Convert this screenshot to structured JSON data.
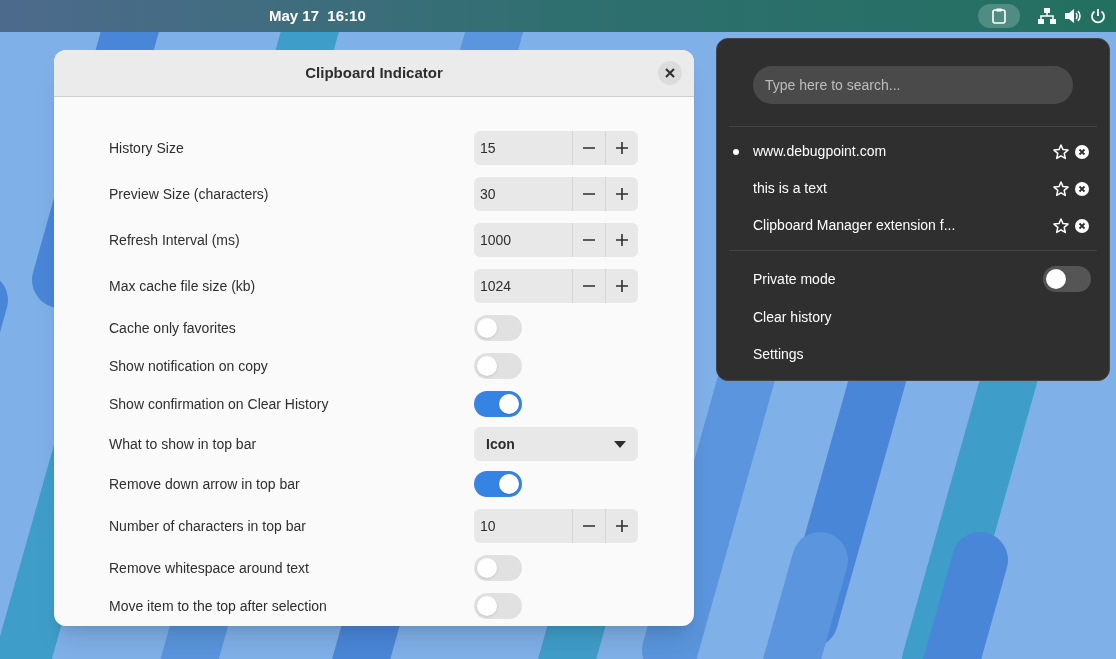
{
  "top_bar": {
    "clock": "May 17  16:10"
  },
  "dialog": {
    "title": "Clipboard Indicator",
    "rows": [
      {
        "kind": "spin",
        "label": "History Size",
        "value": "15"
      },
      {
        "kind": "spin",
        "label": "Preview Size (characters)",
        "value": "30"
      },
      {
        "kind": "spin",
        "label": "Refresh Interval (ms)",
        "value": "1000"
      },
      {
        "kind": "spin",
        "label": "Max cache file size (kb)",
        "value": "1024"
      },
      {
        "kind": "switch",
        "label": "Cache only favorites",
        "on": false
      },
      {
        "kind": "switch",
        "label": "Show notification on copy",
        "on": false
      },
      {
        "kind": "switch",
        "label": "Show confirmation on Clear History",
        "on": true
      },
      {
        "kind": "combo",
        "label": "What to show in top bar",
        "value": "Icon"
      },
      {
        "kind": "switch",
        "label": "Remove down arrow in top bar",
        "on": true
      },
      {
        "kind": "spin",
        "label": "Number of characters in top bar",
        "value": "10"
      },
      {
        "kind": "switch",
        "label": "Remove whitespace around text",
        "on": false
      },
      {
        "kind": "switch",
        "label": "Move item to the top after selection",
        "on": false
      }
    ]
  },
  "popover": {
    "search": {
      "placeholder": "Type here to search..."
    },
    "history": [
      {
        "text": "www.debugpoint.com",
        "selected": true
      },
      {
        "text": "this is a text",
        "selected": false
      },
      {
        "text": "Clipboard Manager extension f...",
        "selected": false
      }
    ],
    "private_mode": {
      "label": "Private mode",
      "on": false
    },
    "actions": [
      "Clear history",
      "Settings"
    ]
  }
}
